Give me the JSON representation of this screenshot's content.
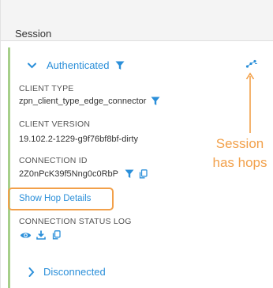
{
  "panel": {
    "title": "Session"
  },
  "authenticated": {
    "label": "Authenticated"
  },
  "client_type": {
    "label": "CLIENT TYPE",
    "value": "zpn_client_type_edge_connector"
  },
  "client_version": {
    "label": "CLIENT VERSION",
    "value": "19.102.2-1229-g9f76bf8bf-dirty"
  },
  "connection_id": {
    "label": "CONNECTION ID",
    "value": "2Z0nPcK39f5Nng0c0RbP"
  },
  "hop_details": {
    "link_label": "Show Hop Details"
  },
  "connection_status_log": {
    "label": "CONNECTION STATUS LOG"
  },
  "disconnected": {
    "label": "Disconnected"
  },
  "annotation": {
    "line1": "Session",
    "line2": "has hops"
  },
  "colors": {
    "accent_blue": "#2b8fd9",
    "annotation_orange": "#f2a04a",
    "status_green": "#a6cf8a"
  },
  "icons": [
    "chevron-down-icon",
    "filter-icon",
    "hops-icon",
    "copy-icon",
    "eye-icon",
    "download-icon",
    "chevron-right-icon"
  ]
}
